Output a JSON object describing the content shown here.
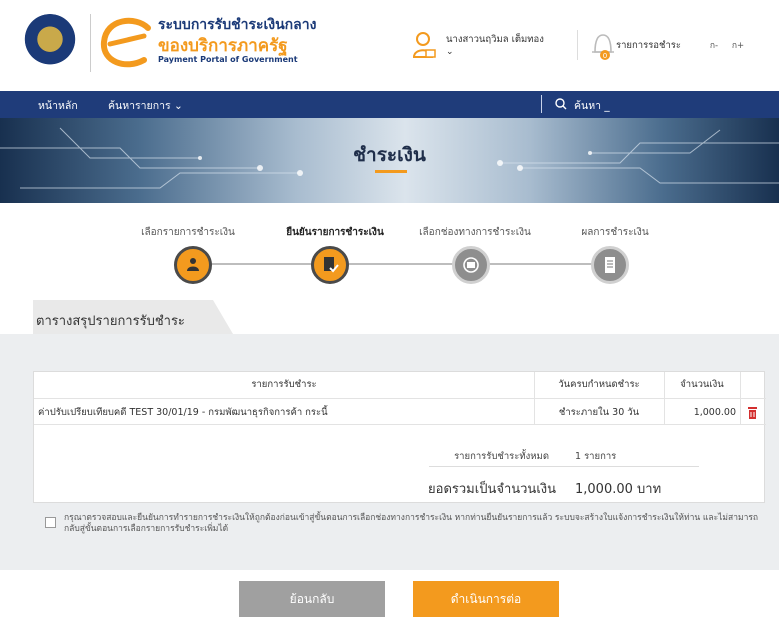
{
  "header": {
    "brand_th_line1": "ระบบการรับชำระเงินกลาง",
    "brand_th_line2": "ของบริการภาครัฐ",
    "brand_en": "Payment Portal of Government",
    "user_name": "นางสาวนฤวิมล เต็มทอง",
    "user_caret": "⌄",
    "pending_label": "รายการรอชำระ",
    "font_smaller": "ก-",
    "font_larger": "ก+"
  },
  "nav": {
    "home": "หน้าหลัก",
    "search_items": "ค้นหารายการ ⌄",
    "search_placeholder": "ค้นหา _"
  },
  "banner": {
    "title": "ชำระเงิน"
  },
  "steps": [
    {
      "label": "เลือกรายการชำระเงิน",
      "active": false
    },
    {
      "label": "ยืนยันรายการชำระเงิน",
      "active": true
    },
    {
      "label": "เลือกช่องทางการชำระเงิน",
      "active": false
    },
    {
      "label": "ผลการชำระเงิน",
      "active": false
    }
  ],
  "summary_tab": "ตารางสรุปรายการรับชำระ",
  "table": {
    "headers": {
      "item": "รายการรับชำระ",
      "due": "วันครบกำหนดชำระ",
      "amount": "จำนวนเงิน"
    },
    "rows": [
      {
        "item": "ค่าปรับเปรียบเทียบคดี TEST 30/01/19 - กรมพัฒนาธุรกิจการค้า กระนี้",
        "due": "ชำระภายใน 30 วัน",
        "amount": "1,000.00"
      }
    ],
    "total_items_label": "รายการรับชำระทั้งหมด",
    "total_items_value": "1 รายการ",
    "total_amount_label": "ยอดรวมเป็นจำนวนเงิน",
    "total_amount_value": "1,000.00 บาท"
  },
  "notice": "กรุณาตรวจสอบและยืนยันการทำรายการชำระเงินให้ถูกต้องก่อนเข้าสู่ขั้นตอนการเลือกช่องทางการชำระเงิน หากท่านยืนยันรายการแล้ว ระบบจะสร้างใบแจ้งการชำระเงินให้ท่าน และไม่สามารถกลับสู่ขั้นตอนการเลือกรายการรับชำระเพิ่มได้",
  "buttons": {
    "back": "ย้อนกลับ",
    "next": "ดำเนินการต่อ"
  },
  "colors": {
    "navy": "#1f3c7a",
    "orange": "#f39a1e",
    "delete": "#d32f2f"
  }
}
